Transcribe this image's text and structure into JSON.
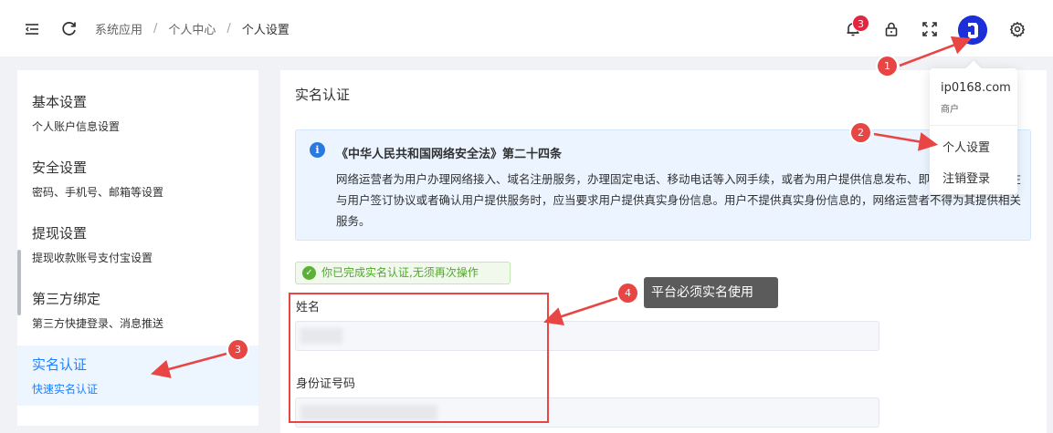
{
  "header": {
    "breadcrumb": [
      "系统应用",
      "个人中心",
      "个人设置"
    ],
    "notification_count": "3",
    "icons": [
      "menu-fold-icon",
      "refresh-icon",
      "bell-icon",
      "lock-icon",
      "fullscreen-icon",
      "avatar",
      "gear-icon"
    ]
  },
  "user_menu": {
    "username": "ip0168.com",
    "role": "商户",
    "items": [
      "个人设置",
      "注销登录"
    ]
  },
  "sidebar": {
    "active_index": 4,
    "items": [
      {
        "title": "基本设置",
        "desc": "个人账户信息设置"
      },
      {
        "title": "安全设置",
        "desc": "密码、手机号、邮箱等设置"
      },
      {
        "title": "提现设置",
        "desc": "提现收款账号支付宝设置"
      },
      {
        "title": "第三方绑定",
        "desc": "第三方快捷登录、消息推送"
      },
      {
        "title": "实名认证",
        "desc": "快速实名认证"
      }
    ]
  },
  "main": {
    "title": "实名认证",
    "notice": {
      "title": "《中华人民共和国网络安全法》第二十四条",
      "body": "网络运营者为用户办理网络接入、域名注册服务，办理固定电话、移动电话等入网手续，或者为用户提供信息发布、即时通讯等服务，在与用户签订协议或者确认用户提供服务时，应当要求用户提供真实身份信息。用户不提供真实身份信息的，网络运营者不得为其提供相关服务。"
    },
    "status": "你已完成实名认证,无须再次操作",
    "fields": [
      {
        "label": "姓名",
        "value": ""
      },
      {
        "label": "身份证号码",
        "value": ""
      }
    ]
  },
  "annotations": {
    "markers": [
      "1",
      "2",
      "3",
      "4"
    ],
    "note": "平台必须实名使用",
    "color": "#e84545"
  },
  "colors": {
    "accent": "#1e80ff",
    "success": "#59b136",
    "badge": "#e3263f"
  }
}
